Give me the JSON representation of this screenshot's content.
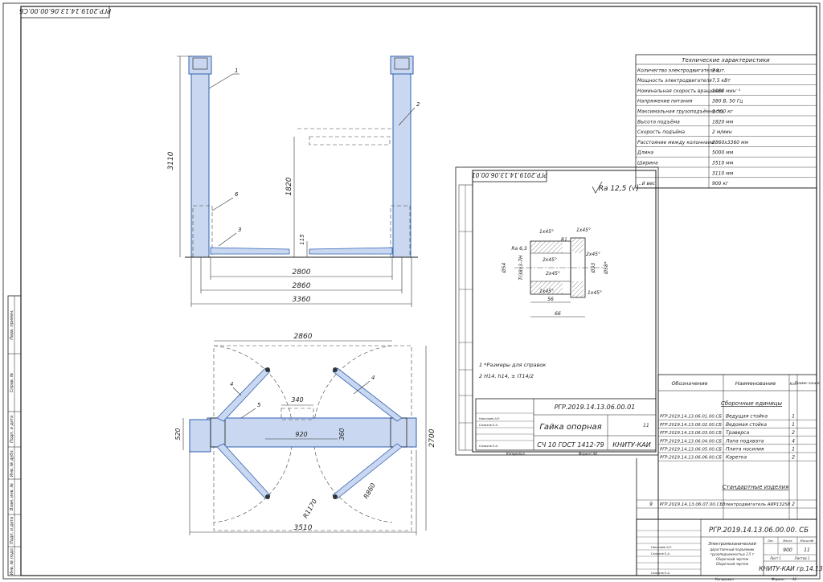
{
  "sheet": {
    "corner_code": "РГР.2019.14.13.06.00.00.СБ",
    "format_label": "Формат",
    "format_value": "А1",
    "copied_label": "Копировал"
  },
  "left_strip": {
    "labels": [
      "Перв. примен.",
      "Справ. №",
      "Подп. и дата",
      "Инв. № дубл.",
      "Взам. инв. №",
      "Подп. и дата",
      "Инв. № подл."
    ]
  },
  "side_view": {
    "callouts": [
      "1",
      "2",
      "6",
      "3"
    ],
    "dims": {
      "height": "3110",
      "lift": "1820",
      "low": "115",
      "w1": "2800",
      "w2": "2860",
      "w3": "3360"
    }
  },
  "top_view": {
    "callouts": [
      "4",
      "5",
      "4"
    ],
    "dims": {
      "top": "2860",
      "a": "340",
      "b": "920",
      "c": "360",
      "left": "520",
      "right": "2700",
      "r1": "R1170",
      "r2": "R860",
      "bottom": "3510"
    }
  },
  "tech": {
    "title": "Технические характеристики",
    "rows": [
      {
        "name": "Количество электродвигателей",
        "value": "2 шт."
      },
      {
        "name": "Мощность электродвигателя",
        "value": "7,5 кВт"
      },
      {
        "name": "Номинальная скорость вращения",
        "value": "1000 мин⁻¹"
      },
      {
        "name": "Напряжение питания",
        "value": "380 В, 50 Гц"
      },
      {
        "name": "Максимальная грузоподъёмность",
        "value": "3 500 кг"
      },
      {
        "name": "Высота подъёма",
        "value": "1820 мм"
      },
      {
        "name": "Скорость подъёма",
        "value": "2 м/мин"
      },
      {
        "name": "Расстояние между колоннами",
        "value": "2860х3360 мм"
      },
      {
        "name": "Длина",
        "value": "5000 мм"
      },
      {
        "name": "Ширина",
        "value": "3510 мм"
      },
      {
        "name": "",
        "value": "3110 мм"
      },
      {
        "name": "...й вес",
        "value": "900 кг"
      }
    ]
  },
  "detail": {
    "code": "РГР.2019.14.13.06.00.01",
    "roughness": "Ra 12,5 (√)",
    "ra_small": "Ra 6,3",
    "labels": {
      "c1": "1х45°",
      "c2": "1х45°",
      "r1": "R1",
      "c3": "2х45°",
      "c4": "2х45°",
      "c5": "2х45°",
      "c6": "1х45°",
      "c7": "1х45°",
      "d54": "Ø54",
      "thread": "Tr38х3-7Н",
      "d33": "Ø33",
      "d58": "Ø58*",
      "l56": "56",
      "l66": "66"
    },
    "notes": [
      "1 *Размеры для справок",
      "2 Н14, h14, ± IT14/2"
    ],
    "title": "Гайка опорная",
    "material": "СЧ 10 ГОСТ 1412-79",
    "org": "КНИТУ-КАИ",
    "sheet_num": "11",
    "stamp_rows": [
      "Изм.",
      "Лист",
      "№ докум.",
      "Подп.",
      "Дата",
      "Разраб.",
      "Пров.",
      "Т.контр.",
      "Н.контр.",
      "Утв."
    ],
    "names": [
      "Николаев А.Р.",
      "Салихов Е.А.",
      "Салихов Е.А."
    ],
    "copied": "Копировал",
    "format": "Формат  А4"
  },
  "spec": {
    "headers": [
      "Обозначение",
      "Наименование",
      "Кол."
    ],
    "headers_extra": [
      "Приме-чание"
    ],
    "section1": "Сборочные единицы",
    "rows": [
      {
        "code": "РГР.2019.14.13.06.01.00.СБ",
        "name": "Ведущая стойка",
        "qty": "1"
      },
      {
        "code": "РГР.2019.14.13.06.02.00.СБ",
        "name": "Ведомая стойка",
        "qty": "1"
      },
      {
        "code": "РГР.2019.14.13.06.03.00.СБ",
        "name": "Траверса",
        "qty": "2"
      },
      {
        "code": "РГР.2019.14.13.06.04.00.СБ",
        "name": "Лапа подхвата",
        "qty": "4"
      },
      {
        "code": "РГР.2019.14.13.06.05.00.СБ",
        "name": "Плита носилия",
        "qty": "1"
      },
      {
        "code": "РГР.2019.14.13.06.06.00.СБ",
        "name": "Каретка",
        "qty": "2"
      }
    ],
    "section2": "Стандартные изделия",
    "std_row": {
      "pos": "9",
      "code": "РГР.2019.14.13.06.07.00.СБ",
      "name": "Электродвигатель АИР132S8",
      "qty": "2"
    }
  },
  "main_stamp": {
    "code": "РГР.2019.14.13.06.00.00. СБ",
    "title_lines": [
      "Электромеханический",
      "двухстоечный подъемник",
      "грузоподъемностью 3,5 т",
      "Сборочный чертеж",
      "Сборочный чертеж"
    ],
    "mass": "900",
    "scale": "1:1",
    "sheet": "11",
    "list_label": "Лист 1",
    "lists_label": "Листов 1",
    "org": "КНИТУ-КАИ гр.14.13",
    "names": [
      "Николаев А.Р.",
      "Салихов Е.А.",
      "Салихов Е.А."
    ],
    "stamp_headers": [
      "Лит.",
      "Масса",
      "Масштаб"
    ]
  }
}
